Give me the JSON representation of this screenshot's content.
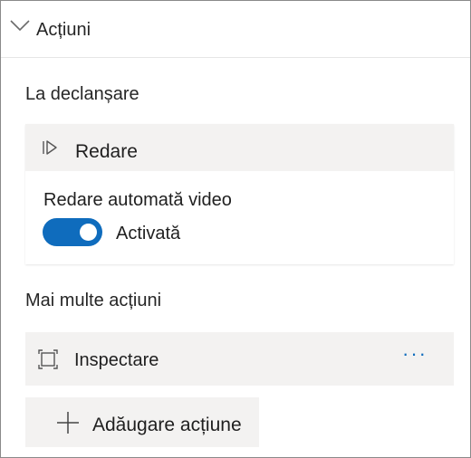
{
  "header": {
    "title": "Acțiuni",
    "icon": "chevron-down-icon"
  },
  "trigger": {
    "label": "La declanșare"
  },
  "action_card": {
    "name": "Redare",
    "icon": "play-icon",
    "option_label": "Redare automată video",
    "toggle": {
      "on": true,
      "state_label": "Activată",
      "color": "#0f6cbd"
    }
  },
  "more_actions": {
    "label": "Mai multe acțiuni",
    "items": [
      {
        "label": "Inspectare",
        "icon": "inspect-icon",
        "menu_icon": "more-options-icon"
      }
    ]
  },
  "add_button": {
    "label": "Adăugare acțiune",
    "icon": "plus-icon"
  }
}
